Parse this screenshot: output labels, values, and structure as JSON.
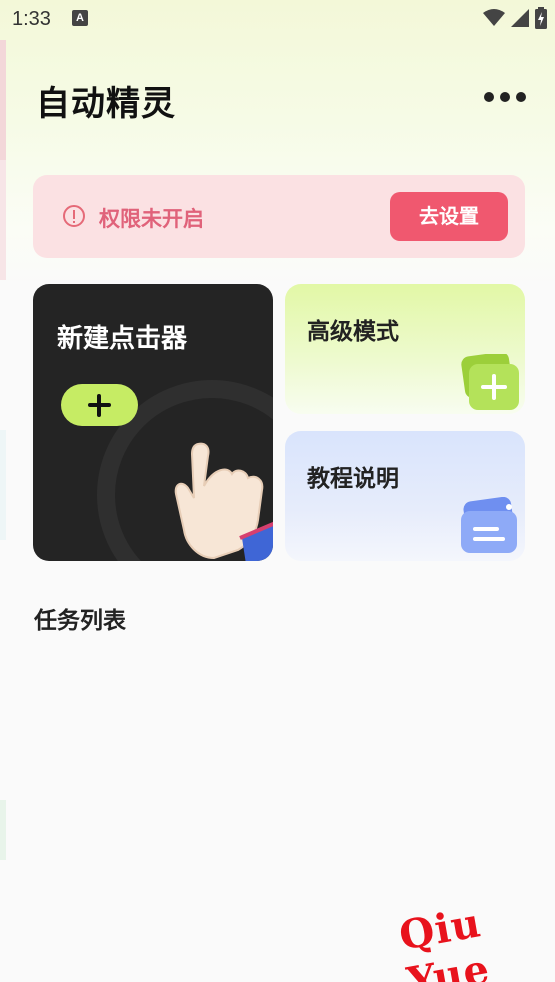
{
  "status_bar": {
    "time": "1:33",
    "notification_icon": "A"
  },
  "header": {
    "title": "自动精灵",
    "more_icon": "more-horizontal-icon"
  },
  "permission_banner": {
    "message": "权限未开启",
    "button_label": "去设置",
    "accent_color": "#f0586f"
  },
  "cards": {
    "new_clicker": {
      "title": "新建点击器"
    },
    "advanced_mode": {
      "title": "高级模式"
    },
    "tutorial": {
      "title": "教程说明"
    }
  },
  "task_list": {
    "title": "任务列表",
    "items": []
  },
  "watermark": "Qiu  Yue"
}
